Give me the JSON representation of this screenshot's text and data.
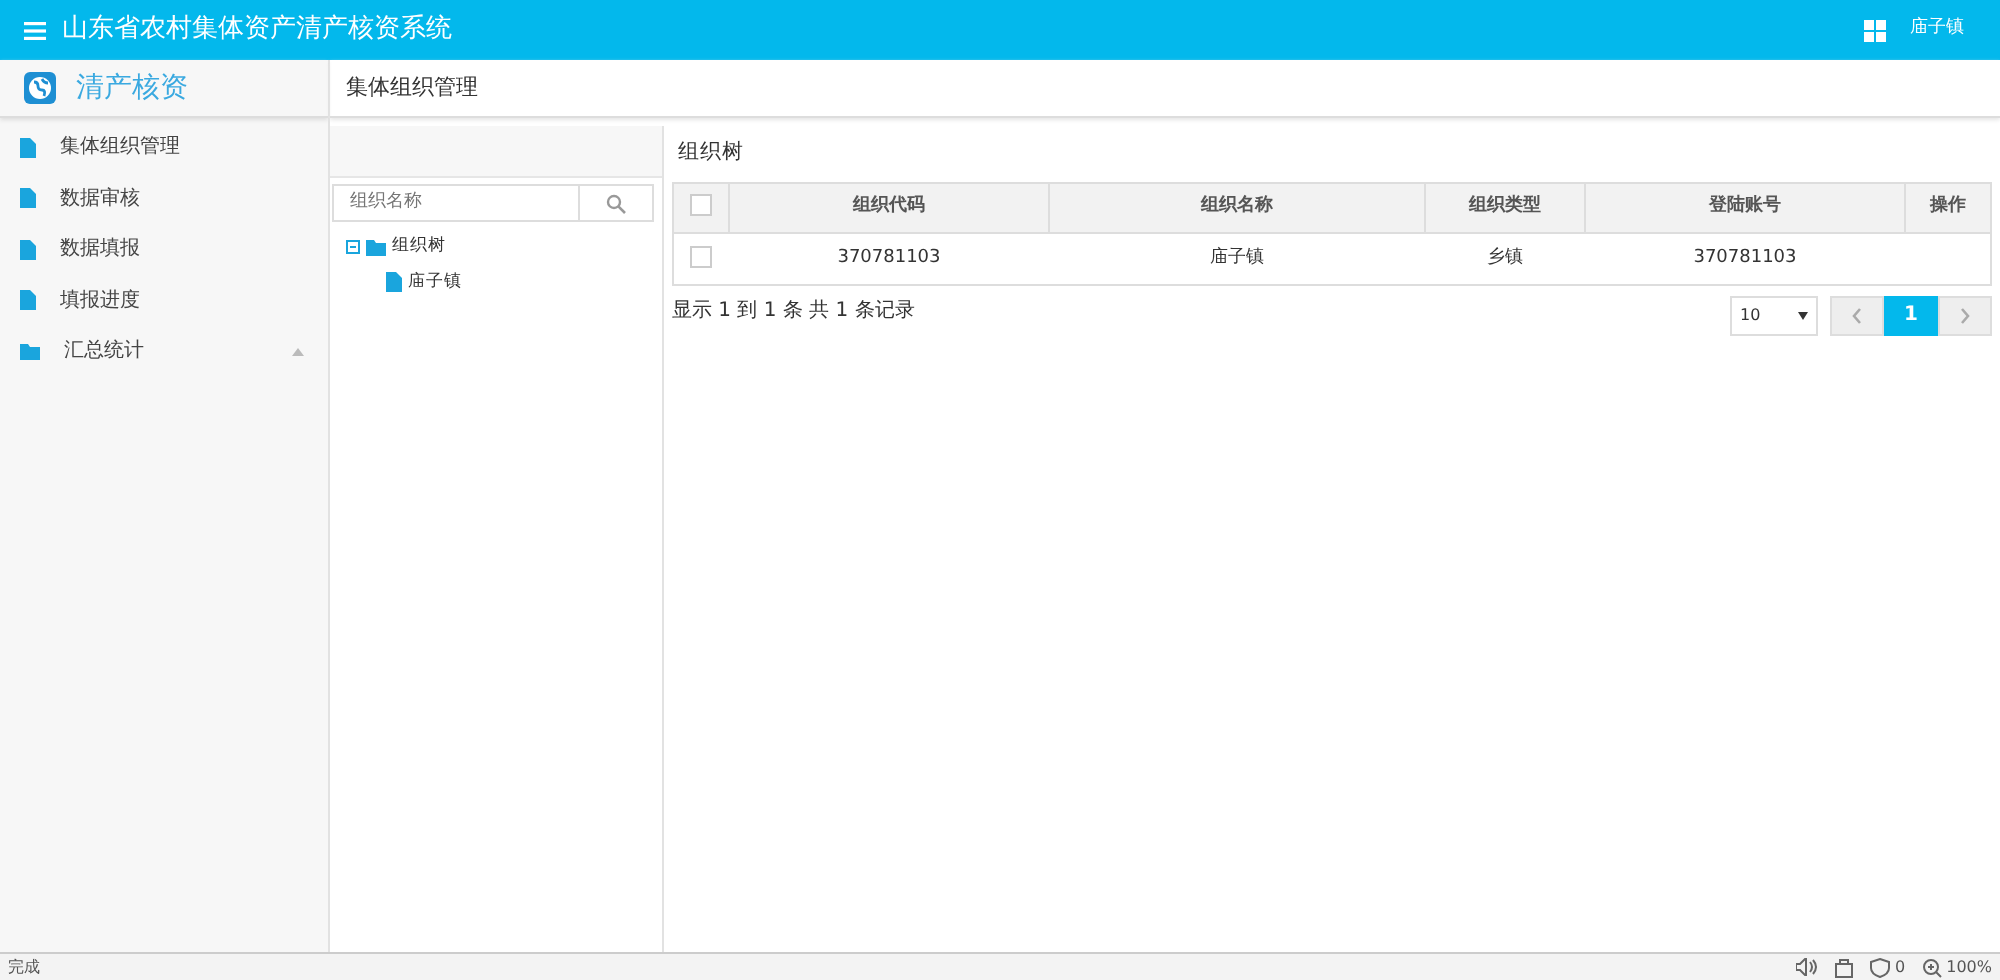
{
  "header": {
    "title": "山东省农村集体资产清产核资系统",
    "user": "庙子镇"
  },
  "sidebar": {
    "title": "清产核资",
    "items": [
      {
        "label": "集体组织管理",
        "kind": "page"
      },
      {
        "label": "数据审核",
        "kind": "page"
      },
      {
        "label": "数据填报",
        "kind": "page"
      },
      {
        "label": "填报进度",
        "kind": "page"
      },
      {
        "label": "汇总统计",
        "kind": "folder",
        "expanded": false
      }
    ]
  },
  "breadcrumb": "集体组织管理",
  "tree_panel": {
    "search": {
      "placeholder": "组织名称"
    },
    "tree": [
      {
        "label": "组织树",
        "expanded": true,
        "children": [
          {
            "label": "庙子镇"
          }
        ]
      }
    ]
  },
  "table_panel": {
    "title": "组织树",
    "columns": [
      "组织代码",
      "组织名称",
      "组织类型",
      "登陆账号",
      "操作"
    ],
    "all_checked": false,
    "rows": [
      {
        "checked": false,
        "cells": [
          "370781103",
          "庙子镇",
          "乡镇",
          "370781103"
        ]
      }
    ],
    "summary": "显示 1 到 1 条 共 1 条记录",
    "page_size": "10",
    "pages": [
      {
        "label": "1",
        "selected": true
      }
    ]
  },
  "status_bar": {
    "text": "完成",
    "blocked": "0",
    "zoom": "100%"
  }
}
